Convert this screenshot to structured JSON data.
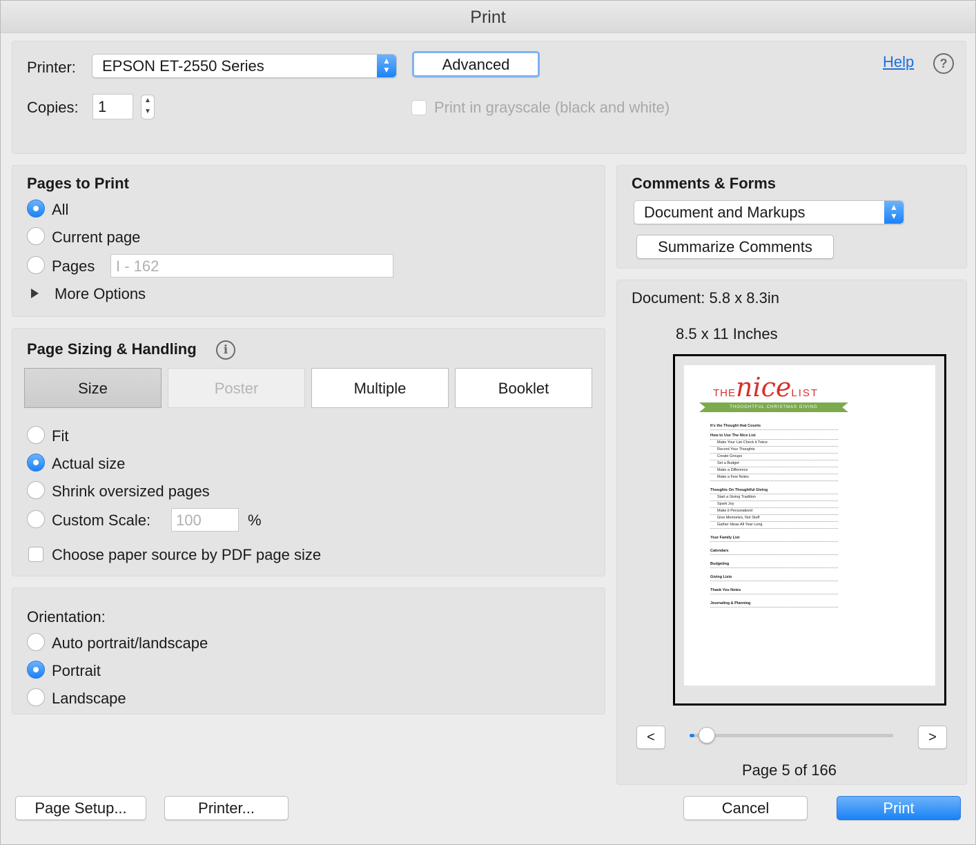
{
  "window": {
    "title": "Print"
  },
  "printer": {
    "label": "Printer:",
    "value": "EPSON ET-2550 Series",
    "advanced": "Advanced",
    "help": "Help",
    "help_icon": "question-icon"
  },
  "copies": {
    "label": "Copies:",
    "value": "1"
  },
  "grayscale": {
    "label": "Print in grayscale (black and white)",
    "checked": false,
    "enabled": false
  },
  "pages_to_print": {
    "title": "Pages to Print",
    "all": "All",
    "current": "Current page",
    "pages": "Pages",
    "pages_placeholder": "I - 162",
    "more_options": "More Options",
    "selected": "All"
  },
  "sizing": {
    "title": "Page Sizing & Handling",
    "tabs": [
      "Size",
      "Poster",
      "Multiple",
      "Booklet"
    ],
    "active_tab": "Size",
    "fit": "Fit",
    "actual": "Actual size",
    "shrink": "Shrink oversized pages",
    "custom": "Custom Scale:",
    "custom_value": "100",
    "percent": "%",
    "paper_source": "Choose paper source by PDF page size",
    "selected": "Actual size"
  },
  "orientation": {
    "title": "Orientation:",
    "auto": "Auto portrait/landscape",
    "portrait": "Portrait",
    "landscape": "Landscape",
    "selected": "Portrait"
  },
  "comments": {
    "title": "Comments & Forms",
    "value": "Document and Markups",
    "summarize": "Summarize Comments"
  },
  "preview": {
    "document": "Document: 5.8 x 8.3in",
    "paper": "8.5 x 11 Inches",
    "prev": "<",
    "next": ">",
    "page_status": "Page 5 of 166",
    "page": 5,
    "total_pages": 166,
    "thumb": {
      "title_the": "THE",
      "title_nice": "nice",
      "title_list": "LIST",
      "banner": "THOUGHTFUL CHRISTMAS GIVING",
      "toc": [
        "It's the Thought that Counts",
        "How to Use The Nice List",
        "Make Your List Check it Twice",
        "Record Your Thoughts",
        "Create Groups",
        "Set a Budget",
        "Make a Difference",
        "Make a Few Notes",
        "Thoughts On Thoughtful Giving",
        "Start a Giving Tradition",
        "Spark Joy",
        "Make it Personalized",
        "Give Memories, Not Stuff",
        "Gather Ideas All Year Long",
        "Your Family List",
        "Calendars",
        "Budgeting",
        "Giving Lists",
        "Thank You Notes",
        "Journaling & Planning"
      ]
    }
  },
  "footer": {
    "page_setup": "Page Setup...",
    "printer": "Printer...",
    "cancel": "Cancel",
    "print": "Print"
  },
  "colors": {
    "accent": "#1a82f7",
    "red": "#d8312b",
    "green": "#7eaa4e"
  }
}
